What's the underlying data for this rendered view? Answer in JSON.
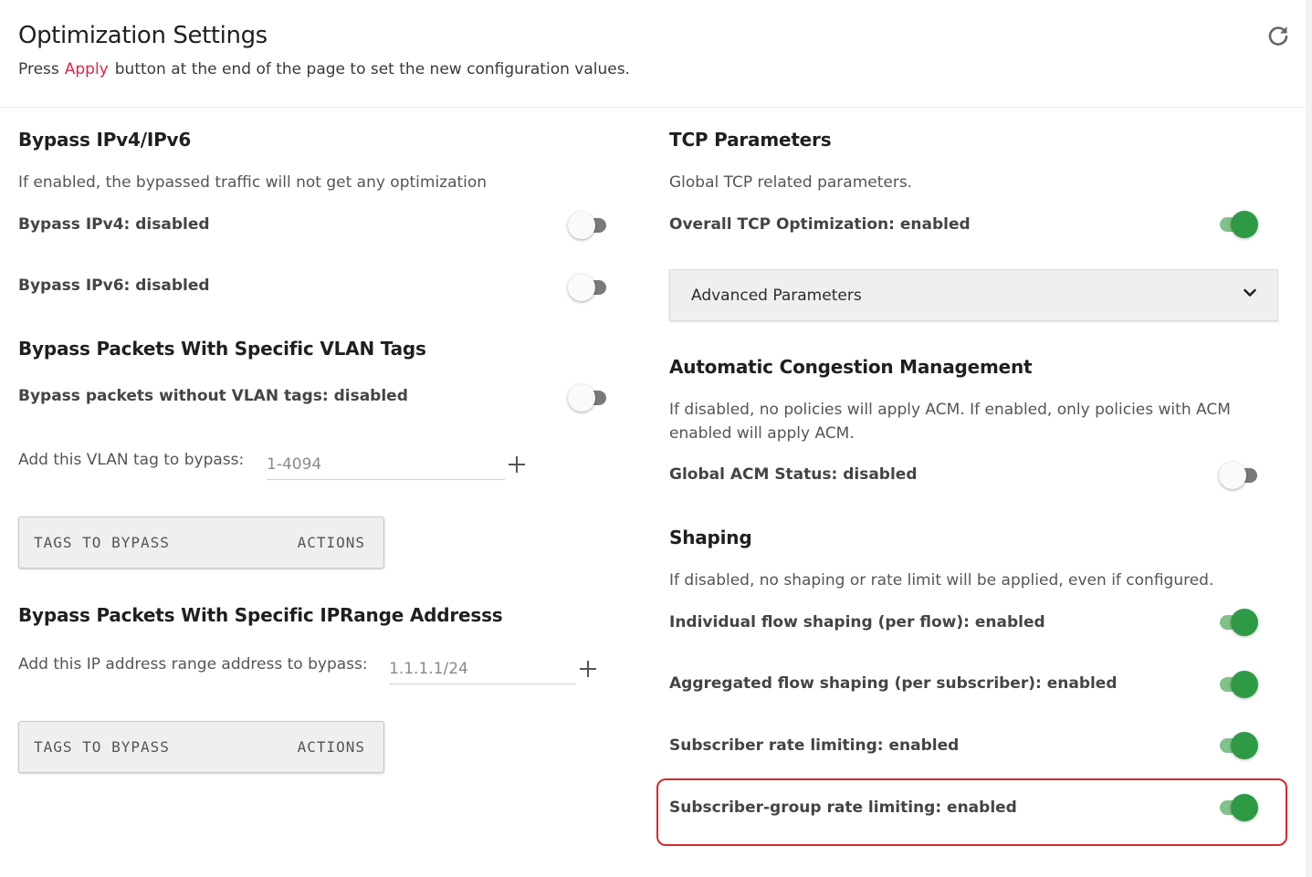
{
  "header": {
    "title": "Optimization Settings",
    "subtitle_before": "Press",
    "apply_link": "Apply",
    "subtitle_after": "button at the end of the page to set the new configuration values.",
    "refresh_icon": "refresh-icon"
  },
  "bypass_ip": {
    "title": "Bypass IPv4/IPv6",
    "description": "If enabled, the bypassed traffic will not get any optimization",
    "ipv4_label": "Bypass IPv4: disabled",
    "ipv4_enabled": false,
    "ipv6_label": "Bypass IPv6: disabled",
    "ipv6_enabled": false
  },
  "bypass_vlan": {
    "title": "Bypass Packets With Specific VLAN Tags",
    "no_vlan_label": "Bypass packets without VLAN tags: disabled",
    "no_vlan_enabled": false,
    "add_label": "Add this VLAN tag to bypass:",
    "add_placeholder": "1-4094",
    "table_col1": "TAGS TO BYPASS",
    "table_col2": "ACTIONS"
  },
  "bypass_iprange": {
    "title": "Bypass Packets With Specific IPRange Addresss",
    "add_label": "Add this IP address range address to bypass:",
    "add_placeholder": "1.1.1.1/24",
    "table_col1": "TAGS TO BYPASS",
    "table_col2": "ACTIONS"
  },
  "tcp": {
    "title": "TCP Parameters",
    "description": "Global TCP related parameters.",
    "overall_label": "Overall TCP Optimization: enabled",
    "overall_enabled": true,
    "advanced_label": "Advanced Parameters"
  },
  "acm": {
    "title": "Automatic Congestion Management",
    "description": "If disabled, no policies will apply ACM. If enabled, only policies with ACM enabled will apply ACM.",
    "status_label": "Global ACM Status: disabled",
    "status_enabled": false
  },
  "shaping": {
    "title": "Shaping",
    "description": "If disabled, no shaping or rate limit will be applied, even if configured.",
    "items": [
      {
        "label": "Individual flow shaping (per flow): enabled",
        "enabled": true
      },
      {
        "label": "Aggregated flow shaping (per subscriber): enabled",
        "enabled": true
      },
      {
        "label": "Subscriber rate limiting: enabled",
        "enabled": true
      },
      {
        "label": "Subscriber-group rate limiting: enabled",
        "enabled": true
      }
    ]
  },
  "colors": {
    "accent_red": "#e2254b",
    "toggle_on": "#2e9a46",
    "highlight_border": "#d62828"
  }
}
